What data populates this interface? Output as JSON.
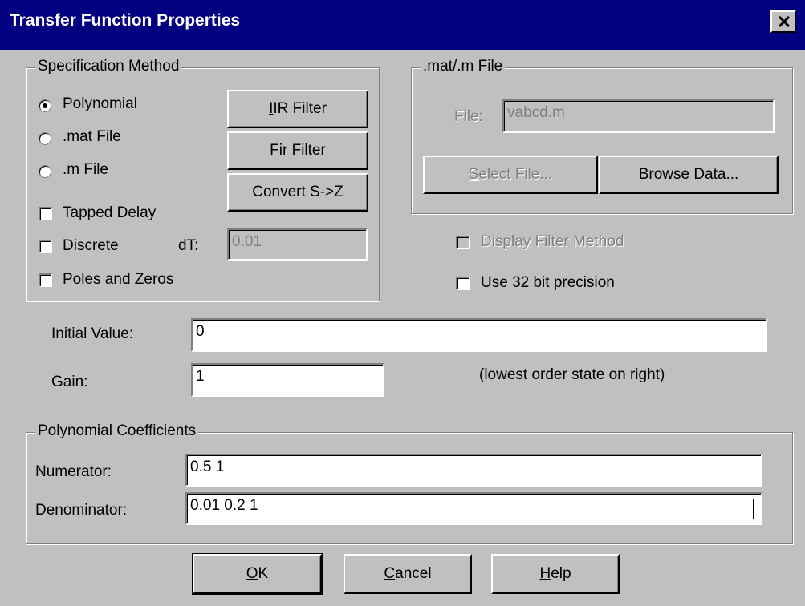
{
  "window": {
    "title": "Transfer Function Properties"
  },
  "spec_method": {
    "legend": "Specification Method",
    "radios": [
      {
        "label": "Polynomial",
        "selected": true
      },
      {
        "label": ".mat File",
        "selected": false
      },
      {
        "label": ".m File",
        "selected": false
      }
    ],
    "checks": [
      {
        "label": "Tapped Delay",
        "checked": false
      },
      {
        "label": "Discrete",
        "checked": false
      },
      {
        "label": "Poles and Zeros",
        "checked": false
      }
    ],
    "dt_label": "dT:",
    "dt_value": "0.01",
    "buttons": {
      "iir": {
        "mnemonic": "I",
        "rest": "IR Filter"
      },
      "fir": {
        "mnemonic": "F",
        "rest": "ir Filter"
      },
      "convert": "Convert S->Z"
    }
  },
  "mat_file": {
    "legend": ".mat/.m File",
    "file_label": "File:",
    "file_value": "vabcd.m",
    "select": {
      "mnemonic": "S",
      "rest": "elect File..."
    },
    "browse": {
      "mnemonic": "B",
      "rest": "rowse Data..."
    }
  },
  "options": {
    "display_filter": "Display Filter Method",
    "use32": "Use 32 bit precision"
  },
  "initial_value": {
    "label": "Initial Value:",
    "value": "0"
  },
  "gain": {
    "label": "Gain:",
    "value": "1"
  },
  "note": "(lowest order state on right)",
  "poly": {
    "legend": "Polynomial Coefficients",
    "numerator_label": "Numerator:",
    "numerator_value": "0.5 1",
    "denominator_label": "Denominator:",
    "denominator_value": "0.01 0.2 1"
  },
  "footer": {
    "ok": {
      "mnemonic": "O",
      "rest": "K"
    },
    "cancel": {
      "mnemonic": "C",
      "rest": "ancel"
    },
    "help": {
      "mnemonic": "H",
      "rest": "elp"
    }
  }
}
